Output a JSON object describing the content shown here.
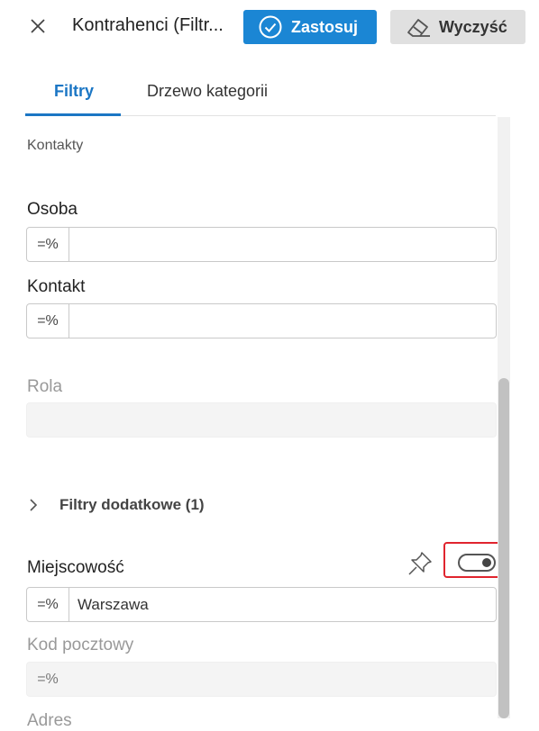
{
  "header": {
    "title": "Kontrahenci (Filtr...",
    "apply_label": "Zastosuj",
    "clear_label": "Wyczyść"
  },
  "tabs": [
    {
      "label": "Filtry",
      "active": true
    },
    {
      "label": "Drzewo kategorii",
      "active": false
    }
  ],
  "content": {
    "section_title": "Kontakty",
    "fields": [
      {
        "label": "Osoba",
        "operator": "=%",
        "value": "",
        "disabled": false
      },
      {
        "label": "Kontakt",
        "operator": "=%",
        "value": "",
        "disabled": false
      },
      {
        "label": "Rola",
        "operator": "",
        "value": "",
        "disabled": true
      }
    ],
    "additional_filters": {
      "label": "Filtry dodatkowe (1)",
      "expanded": false
    },
    "extra_fields": [
      {
        "label": "Miejscowość",
        "operator": "=%",
        "value": "Warszawa",
        "disabled": false,
        "toggle_on": true
      },
      {
        "label": "Kod pocztowy",
        "operator": "=%",
        "value": "",
        "disabled": true
      }
    ],
    "next_label": "Adres"
  },
  "colors": {
    "accent": "#1b86d4",
    "tab_active": "#1b76c4",
    "highlight": "#e0242e",
    "disabled_text": "#999999"
  },
  "icons": {
    "close": "close-icon",
    "apply": "check-circle-icon",
    "clear": "eraser-icon",
    "expand": "chevron-right-icon",
    "pin": "pin-icon"
  }
}
